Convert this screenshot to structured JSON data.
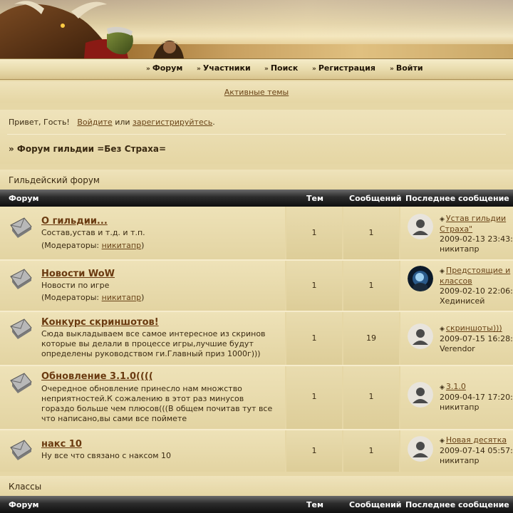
{
  "nav": {
    "items": [
      "Форум",
      "Участники",
      "Поиск",
      "Регистрация",
      "Войти"
    ]
  },
  "active_topics": "Активные темы",
  "greeting": {
    "prefix": "Привет, Гость!",
    "login": "Войдите",
    "or": "или",
    "register": "зарегистрируйтесь",
    "suffix": "."
  },
  "breadcrumb": "» Форум гильдии =Без Страха=",
  "columns": {
    "forum": "Форум",
    "topics": "Тем",
    "posts": "Сообщений",
    "last": "Последнее сообщение"
  },
  "categories": [
    {
      "title": "Гильдейский форум",
      "forums": [
        {
          "name": "О гильдии...",
          "desc": "Состав,устав и т.д. и т.п.",
          "mod_prefix": "(Модераторы:",
          "mod_name": "никитапр",
          "mod_suffix": ")",
          "topics": "1",
          "posts": "1",
          "last_title_1": "Устав гильдии",
          "last_title_2": "Страха\"",
          "last_date": "2009-02-13 23:43:",
          "last_user": "никитапр",
          "avatar": "default"
        },
        {
          "name": "Новости WoW",
          "desc": "Новости по игре",
          "mod_prefix": "(Модераторы:",
          "mod_name": "никитапр",
          "mod_suffix": ")",
          "topics": "1",
          "posts": "1",
          "last_title_1": "Предстоящие и",
          "last_title_2": "классов",
          "last_date": "2009-02-10 22:06:",
          "last_user": "Хединисей",
          "avatar": "custom"
        },
        {
          "name": "Конкурс скриншотов!",
          "desc_lines": [
            "Сюда выкладываем все самое интересное из скринов",
            "которые вы делали в процессе игры,лучшие будут",
            "определены руководством ги.Главный приз 1000г)))"
          ],
          "topics": "1",
          "posts": "19",
          "last_title_1": "скриншоты)))",
          "last_date": "2009-07-15 16:28:",
          "last_user": "Verendor",
          "avatar": "default"
        },
        {
          "name": "Обновление 3.1.0((((",
          "desc_lines": [
            "Очередное обновление принесло нам множство",
            "неприятностей.К сожалению в этот раз минусов",
            "гораздо больше чем плюсов(((В общем почитав тут все",
            "что написано,вы сами все поймете"
          ],
          "topics": "1",
          "posts": "1",
          "last_title_1": "3.1.0",
          "last_date": "2009-04-17 17:20:",
          "last_user": "никитапр",
          "avatar": "default"
        },
        {
          "name": "накс 10",
          "desc": "Ну все что связано с наксом 10",
          "topics": "1",
          "posts": "1",
          "last_title_1": "Новая десятка",
          "last_date": "2009-07-14 05:57:",
          "last_user": "никитапр",
          "avatar": "default"
        }
      ]
    },
    {
      "title": "Классы"
    }
  ]
}
